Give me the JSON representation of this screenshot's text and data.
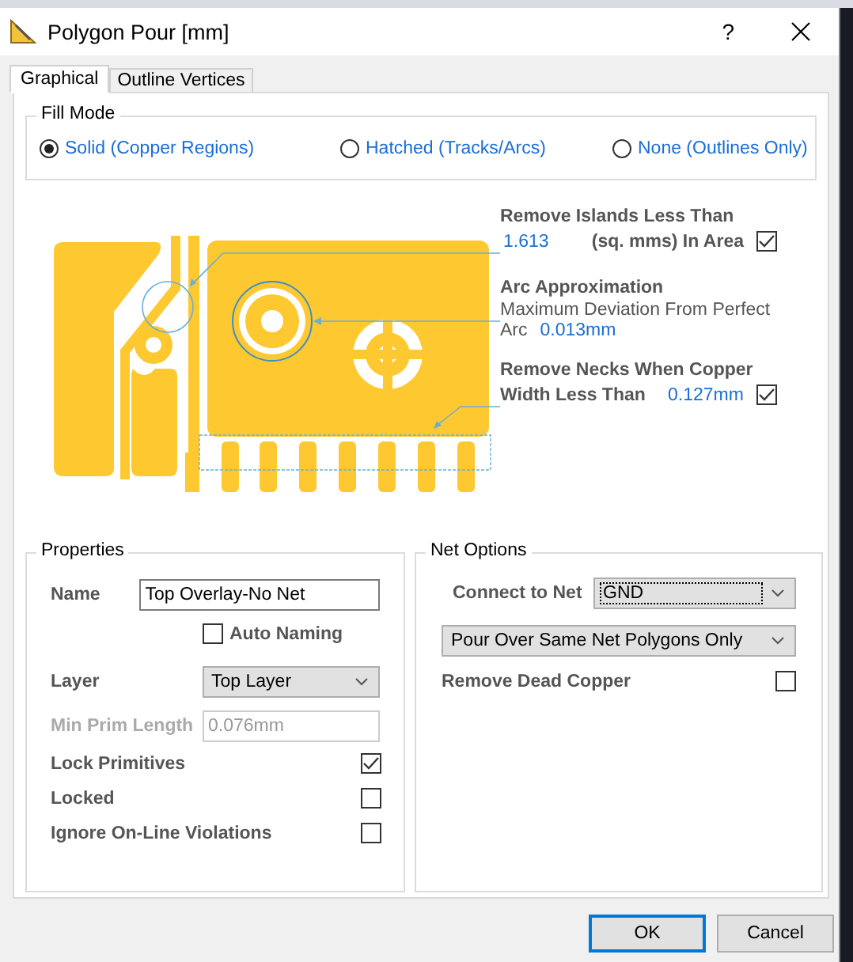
{
  "window": {
    "title": "Polygon Pour [mm]",
    "help": "?"
  },
  "tabs": [
    {
      "label": "Graphical",
      "selected": true
    },
    {
      "label": "Outline Vertices",
      "selected": false
    }
  ],
  "fill_mode": {
    "title": "Fill Mode",
    "options": [
      {
        "label": "Solid (Copper Regions)",
        "selected": true
      },
      {
        "label": "Hatched (Tracks/Arcs)",
        "selected": false
      },
      {
        "label": "None (Outlines Only)",
        "selected": false
      }
    ]
  },
  "diagram": {
    "islands": {
      "title": "Remove Islands Less Than",
      "value": "1.613",
      "unit_label": "(sq. mms) In Area",
      "checked": true
    },
    "arc": {
      "title": "Arc Approximation",
      "description": "Maximum Deviation From Perfect",
      "arc_label": "Arc",
      "value": "0.013mm"
    },
    "necks": {
      "title": "Remove Necks When Copper",
      "label": "Width Less Than",
      "value": "0.127mm",
      "checked": true
    }
  },
  "properties": {
    "title": "Properties",
    "name": {
      "label": "Name",
      "value": "Top Overlay-No Net"
    },
    "auto_naming": {
      "label": "Auto Naming",
      "checked": false
    },
    "layer": {
      "label": "Layer",
      "value": "Top Layer"
    },
    "min_prim": {
      "label": "Min Prim Length",
      "value": "0.076mm",
      "disabled": true
    },
    "checks": [
      {
        "label": "Lock Primitives",
        "checked": true
      },
      {
        "label": "Locked",
        "checked": false
      },
      {
        "label": "Ignore On-Line Violations",
        "checked": false
      }
    ]
  },
  "net_options": {
    "title": "Net Options",
    "connect": {
      "label": "Connect to Net",
      "value": "GND",
      "focused": true
    },
    "pour_mode": {
      "value": "Pour Over Same Net Polygons Only"
    },
    "remove_dead": {
      "label": "Remove Dead Copper",
      "checked": false
    }
  },
  "buttons": [
    {
      "label": "OK",
      "default": true
    },
    {
      "label": "Cancel",
      "default": false
    }
  ]
}
